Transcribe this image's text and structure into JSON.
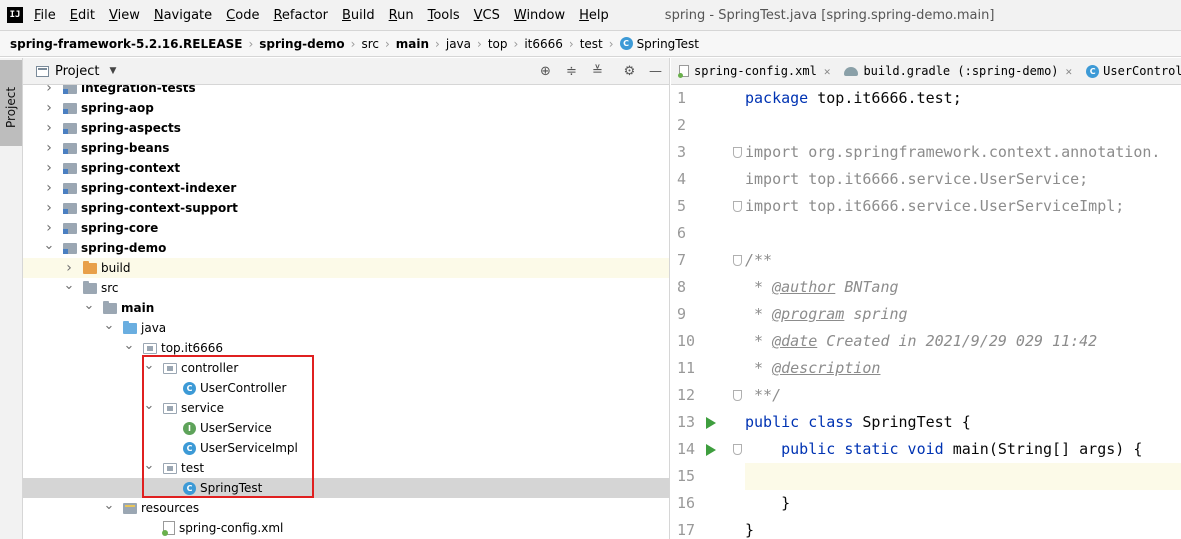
{
  "menubar": {
    "app_icon_text": "IJ",
    "items": [
      {
        "first": "F",
        "rest": "ile"
      },
      {
        "first": "E",
        "rest": "dit"
      },
      {
        "first": "V",
        "rest": "iew"
      },
      {
        "first": "N",
        "rest": "avigate"
      },
      {
        "first": "C",
        "rest": "ode"
      },
      {
        "first": "R",
        "rest": "efactor"
      },
      {
        "first": "B",
        "rest": "uild"
      },
      {
        "first": "R",
        "rest": "un"
      },
      {
        "first": "T",
        "rest": "ools"
      },
      {
        "first": "V",
        "rest": "CS"
      },
      {
        "first": "W",
        "rest": "indow"
      },
      {
        "first": "H",
        "rest": "elp"
      }
    ],
    "window_title": "spring - SpringTest.java [spring.spring-demo.main]"
  },
  "breadcrumb": {
    "items": [
      "spring-framework-5.2.16.RELEASE",
      "spring-demo",
      "src",
      "main",
      "java",
      "top",
      "it6666",
      "test",
      "SpringTest"
    ]
  },
  "tool_stripe": {
    "project_tab": "Project"
  },
  "project_panel": {
    "title": "Project",
    "tree": [
      {
        "label": "integration-tests",
        "depth": 0,
        "arrow": "right",
        "icon": "module",
        "bold": true
      },
      {
        "label": "spring-aop",
        "depth": 0,
        "arrow": "right",
        "icon": "module",
        "bold": true
      },
      {
        "label": "spring-aspects",
        "depth": 0,
        "arrow": "right",
        "icon": "module",
        "bold": true
      },
      {
        "label": "spring-beans",
        "depth": 0,
        "arrow": "right",
        "icon": "module",
        "bold": true
      },
      {
        "label": "spring-context",
        "depth": 0,
        "arrow": "right",
        "icon": "module",
        "bold": true
      },
      {
        "label": "spring-context-indexer",
        "depth": 0,
        "arrow": "right",
        "icon": "module",
        "bold": true
      },
      {
        "label": "spring-context-support",
        "depth": 0,
        "arrow": "right",
        "icon": "module",
        "bold": true
      },
      {
        "label": "spring-core",
        "depth": 0,
        "arrow": "right",
        "icon": "module",
        "bold": true
      },
      {
        "label": "spring-demo",
        "depth": 0,
        "arrow": "down",
        "icon": "module",
        "bold": true
      },
      {
        "label": "build",
        "depth": 1,
        "arrow": "right",
        "icon": "orange",
        "bold": false,
        "hl": true
      },
      {
        "label": "src",
        "depth": 1,
        "arrow": "down",
        "icon": "src",
        "bold": false
      },
      {
        "label": "main",
        "depth": 2,
        "arrow": "down",
        "icon": "src",
        "bold": true
      },
      {
        "label": "java",
        "depth": 3,
        "arrow": "down",
        "icon": "blue",
        "bold": false
      },
      {
        "label": "top.it6666",
        "depth": 4,
        "arrow": "down",
        "icon": "pkg",
        "bold": false
      },
      {
        "label": "controller",
        "depth": 5,
        "arrow": "down",
        "icon": "pkg",
        "bold": false
      },
      {
        "label": "UserController",
        "depth": 6,
        "arrow": "none",
        "icon": "class-c",
        "bold": false
      },
      {
        "label": "service",
        "depth": 5,
        "arrow": "down",
        "icon": "pkg",
        "bold": false
      },
      {
        "label": "UserService",
        "depth": 6,
        "arrow": "none",
        "icon": "class-i",
        "bold": false
      },
      {
        "label": "UserServiceImpl",
        "depth": 6,
        "arrow": "none",
        "icon": "class-c",
        "bold": false
      },
      {
        "label": "test",
        "depth": 5,
        "arrow": "down",
        "icon": "pkg",
        "bold": false
      },
      {
        "label": "SpringTest",
        "depth": 6,
        "arrow": "none",
        "icon": "class-ct",
        "bold": false,
        "selected": true
      },
      {
        "label": "resources",
        "depth": 3,
        "arrow": "down",
        "icon": "res",
        "bold": false
      },
      {
        "label": "spring-config.xml",
        "depth": 5,
        "arrow": "none",
        "icon": "xml",
        "bold": false
      }
    ]
  },
  "editor": {
    "tabs": [
      {
        "label": "spring-config.xml",
        "icon": "xml"
      },
      {
        "label": "build.gradle (:spring-demo)",
        "icon": "gradle"
      },
      {
        "label": "UserControll",
        "icon": "class"
      }
    ],
    "lines": [
      {
        "no": "1"
      },
      {
        "no": "2"
      },
      {
        "no": "3"
      },
      {
        "no": "4"
      },
      {
        "no": "5"
      },
      {
        "no": "6"
      },
      {
        "no": "7"
      },
      {
        "no": "8"
      },
      {
        "no": "9"
      },
      {
        "no": "10"
      },
      {
        "no": "11"
      },
      {
        "no": "12"
      },
      {
        "no": "13"
      },
      {
        "no": "14"
      },
      {
        "no": "15"
      },
      {
        "no": "16"
      },
      {
        "no": "17"
      }
    ],
    "code": {
      "l1_kw": "package",
      "l1_rest": " top.it6666.test;",
      "l3": "import org.springframework.context.annotation.",
      "l4": "import top.it6666.service.UserService;",
      "l5": "import top.it6666.service.UserServiceImpl;",
      "l7": "/**",
      "l8_pre": " * ",
      "l8_tag": "@author",
      "l8_rest": " BNTang",
      "l9_pre": " * ",
      "l9_tag": "@program",
      "l9_rest": " spring",
      "l10_pre": " * ",
      "l10_tag": "@date",
      "l10_rest": " Created in 2021/9/29 029 11:42",
      "l11_pre": " * ",
      "l11_tag": "@description",
      "l12": " **/",
      "l13_kw": "public class",
      "l13_rest": " SpringTest {",
      "l14_indent": "    ",
      "l14_kw": "public static void",
      "l14_rest": " main(String[] args) {",
      "l16": "    }",
      "l17": "}"
    }
  }
}
